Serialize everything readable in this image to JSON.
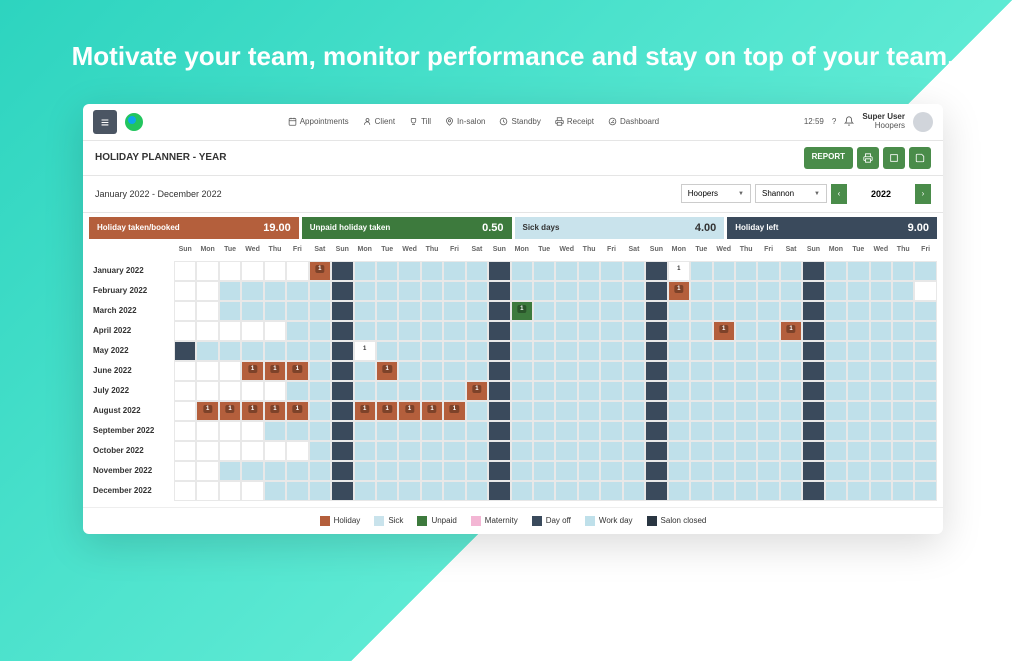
{
  "hero": "Motivate your team, monitor performance and stay on top of your team.",
  "topnav": {
    "appointments": "Appointments",
    "client": "Client",
    "till": "Till",
    "insalon": "In-salon",
    "standby": "Standby",
    "receipt": "Receipt",
    "dashboard": "Dashboard"
  },
  "time": "12:59",
  "user": {
    "name": "Super User",
    "org": "Hoopers"
  },
  "page_title": "HOLIDAY PLANNER - YEAR",
  "report_btn": "REPORT",
  "daterange": "January 2022 - December 2022",
  "filter_org": "Hoopers",
  "filter_person": "Shannon",
  "year": "2022",
  "stats": [
    {
      "label": "Holiday taken/booked",
      "value": "19.00"
    },
    {
      "label": "Unpaid holiday taken",
      "value": "0.50"
    },
    {
      "label": "Sick days",
      "value": "4.00"
    },
    {
      "label": "Holiday left",
      "value": "9.00"
    }
  ],
  "day_headers": [
    "Sun",
    "Mon",
    "Tue",
    "Wed",
    "Thu",
    "Fri",
    "Sat",
    "Sun",
    "Mon",
    "Tue",
    "Wed",
    "Thu",
    "Fri",
    "Sat",
    "Sun",
    "Mon",
    "Tue",
    "Wed",
    "Thu",
    "Fri",
    "Sat",
    "Sun",
    "Mon",
    "Tue",
    "Wed",
    "Thu",
    "Fri",
    "Sat",
    "Sun",
    "Mon",
    "Tue",
    "Wed",
    "Thu",
    "Fri"
  ],
  "months": [
    "January 2022",
    "February 2022",
    "March 2022",
    "April 2022",
    "May 2022",
    "June 2022",
    "July 2022",
    "August 2022",
    "September 2022",
    "October 2022",
    "November 2022",
    "December 2022"
  ],
  "legend": {
    "holiday": "Holiday",
    "sick": "Sick",
    "unpaid": "Unpaid",
    "maternity": "Maternity",
    "dayoff": "Day off",
    "workday": "Work day",
    "closed": "Salon closed"
  },
  "colors": {
    "holiday": "#b45f3c",
    "sick": "#c9e3ec",
    "unpaid": "#3d7a3d",
    "maternity": "#f3b6d4",
    "dayoff": "#3a4a5c",
    "workday": "#bfe0ea",
    "closed": "#2a3642"
  },
  "calendar": [
    {
      "m": "January 2022",
      "start": 6,
      "days": 31,
      "cells": {
        "1": "hB",
        "2": "o",
        "9": "o",
        "16": "o",
        "17": "nW1",
        "23": "o",
        "30": "o"
      }
    },
    {
      "m": "February 2022",
      "start": 2,
      "days": 28,
      "cells": {
        "6": "o",
        "13": "o",
        "20": "o",
        "21": "hB",
        "27": "o"
      }
    },
    {
      "m": "March 2022",
      "start": 2,
      "days": 31,
      "cells": {
        "6": "o",
        "13": "o",
        "14": "uB",
        "20": "o",
        "27": "o"
      }
    },
    {
      "m": "April 2022",
      "start": 5,
      "days": 30,
      "cells": {
        "3": "o",
        "10": "o",
        "17": "o",
        "20": "hB",
        "24": "o",
        "23": "hB",
        "31": "nW1"
      }
    },
    {
      "m": "May 2022",
      "start": 0,
      "days": 31,
      "cells": {
        "1": "o",
        "8": "o",
        "9": "nW1",
        "15": "o",
        "22": "o",
        "29": "o"
      }
    },
    {
      "m": "June 2022",
      "start": 3,
      "days": 30,
      "cells": {
        "1": "hB",
        "2": "hB",
        "3": "hB",
        "5": "o",
        "7": "hB",
        "12": "o",
        "19": "o",
        "26": "o"
      }
    },
    {
      "m": "July 2022",
      "start": 5,
      "days": 31,
      "cells": {
        "3": "o",
        "9": "hB",
        "10": "o",
        "17": "o",
        "24": "o",
        "31": "o"
      }
    },
    {
      "m": "August 2022",
      "start": 1,
      "days": 31,
      "cells": {
        "1": "hB",
        "2": "hB",
        "3": "hB",
        "4": "hB",
        "5": "hB",
        "7": "o",
        "8": "hB",
        "9": "hB",
        "10": "hB",
        "11": "hB",
        "12": "hB",
        "14": "o",
        "21": "o",
        "28": "o"
      }
    },
    {
      "m": "September 2022",
      "start": 4,
      "days": 30,
      "cells": {
        "4": "o",
        "11": "o",
        "18": "o",
        "25": "o"
      }
    },
    {
      "m": "October 2022",
      "start": 6,
      "days": 31,
      "cells": {
        "2": "o",
        "9": "o",
        "16": "o",
        "23": "o",
        "30": "o"
      }
    },
    {
      "m": "November 2022",
      "start": 2,
      "days": 30,
      "cells": {
        "6": "o",
        "13": "o",
        "20": "o",
        "27": "o"
      }
    },
    {
      "m": "December 2022",
      "start": 4,
      "days": 31,
      "cells": {
        "4": "o",
        "11": "o",
        "18": "o",
        "25": "o"
      }
    }
  ]
}
